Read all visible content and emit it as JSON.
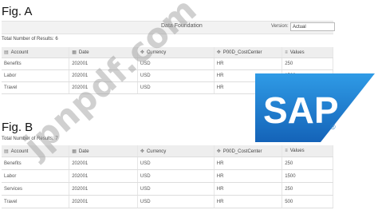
{
  "fig_a": {
    "label": "Fig. A",
    "toolbar": {
      "title": "Data Foundation",
      "version_label": "Version:",
      "version_value": "Actual"
    },
    "results_text": "Total Number of Results: 6",
    "columns": [
      "Account",
      "Date",
      "Currency",
      "P00D_CostCenter",
      "Values"
    ],
    "column_icons": [
      "table-icon",
      "calendar-icon",
      "dimension-icon",
      "dimension-icon",
      "measure-icon"
    ],
    "rows": [
      [
        "Benefits",
        "202001",
        "USD",
        "HR",
        "250"
      ],
      [
        "Labor",
        "202001",
        "USD",
        "HR",
        "1500"
      ],
      [
        "Travel",
        "202001",
        "USD",
        "HR",
        ""
      ]
    ]
  },
  "fig_b": {
    "label": "Fig. B",
    "results_text": "Total Number of Results: 7",
    "columns": [
      "Account",
      "Date",
      "Currency",
      "P00D_CostCenter",
      "Values"
    ],
    "column_icons": [
      "table-icon",
      "calendar-icon",
      "dimension-icon",
      "dimension-icon",
      "measure-icon"
    ],
    "rows": [
      [
        "Benefits",
        "202001",
        "USD",
        "HR",
        "250"
      ],
      [
        "Labor",
        "202001",
        "USD",
        "HR",
        "1500"
      ],
      [
        "Services",
        "202001",
        "USD",
        "HR",
        "250"
      ],
      [
        "Travel",
        "202001",
        "USD",
        "HR",
        "500"
      ]
    ]
  },
  "watermark": "jpnpdf.com",
  "logo": {
    "text": "SAP",
    "color": "#1a73c8",
    "registered": "®"
  },
  "colors": {
    "header_bg": "#eeeeee",
    "toolbar_bg": "#f2f2f2",
    "border": "#dddddd"
  }
}
